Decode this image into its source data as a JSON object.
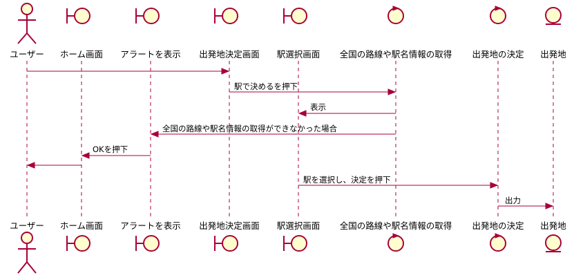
{
  "participants": [
    {
      "id": "user",
      "label": "ユーザー",
      "kind": "actor"
    },
    {
      "id": "home",
      "label": "ホーム画面",
      "kind": "boundary"
    },
    {
      "id": "alert",
      "label": "アラートを表示",
      "kind": "boundary"
    },
    {
      "id": "origin_screen",
      "label": "出発地決定画面",
      "kind": "boundary"
    },
    {
      "id": "station_screen",
      "label": "駅選択画面",
      "kind": "boundary"
    },
    {
      "id": "fetch",
      "label": "全国の路線や駅名情報の取得",
      "kind": "control"
    },
    {
      "id": "decide",
      "label": "出発地の決定",
      "kind": "control"
    },
    {
      "id": "origin",
      "label": "出発地",
      "kind": "entity"
    }
  ],
  "messages": [
    {
      "from": "user",
      "to": "origin_screen",
      "label": ""
    },
    {
      "from": "origin_screen",
      "to": "fetch",
      "label": "駅で決めるを押下"
    },
    {
      "from": "fetch",
      "to": "station_screen",
      "label": "表示"
    },
    {
      "from": "fetch",
      "to": "alert",
      "label": "全国の路線や駅名情報の取得ができなかった場合"
    },
    {
      "from": "alert",
      "to": "home",
      "label": "OKを押下"
    },
    {
      "from": "home",
      "to": "user",
      "label": ""
    },
    {
      "from": "station_screen",
      "to": "decide",
      "label": "駅を選択し、決定を押下"
    },
    {
      "from": "decide",
      "to": "origin",
      "label": "出力"
    }
  ]
}
